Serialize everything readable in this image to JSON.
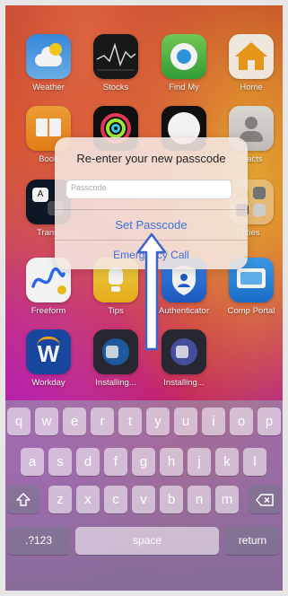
{
  "home": {
    "apps": [
      {
        "id": "weather",
        "label": "Weather"
      },
      {
        "id": "stocks",
        "label": "Stocks"
      },
      {
        "id": "findmy",
        "label": "Find My"
      },
      {
        "id": "home",
        "label": "Home"
      },
      {
        "id": "books",
        "label": "Book"
      },
      {
        "id": "fitness",
        "label": ""
      },
      {
        "id": "clock",
        "label": ""
      },
      {
        "id": "contacts",
        "label": "ntacts"
      },
      {
        "id": "translate",
        "label": "Transl"
      },
      {
        "id": "utilities",
        "label": "lities"
      },
      {
        "id": "freeform",
        "label": "Freeform"
      },
      {
        "id": "tips",
        "label": "Tips"
      },
      {
        "id": "authenticator",
        "label": "Authenticator"
      },
      {
        "id": "compportal",
        "label": "Comp Portal"
      },
      {
        "id": "workday",
        "label": "Workday"
      },
      {
        "id": "installing1",
        "label": "Installing..."
      },
      {
        "id": "installing2",
        "label": "Installing..."
      }
    ]
  },
  "alert": {
    "title": "Re-enter your new passcode",
    "placeholder": "Passcode",
    "primary_button": "Set Passcode",
    "secondary_button": "Emergency Call"
  },
  "keyboard": {
    "row1": [
      "q",
      "w",
      "e",
      "r",
      "t",
      "y",
      "u",
      "i",
      "o",
      "p"
    ],
    "row2": [
      "a",
      "s",
      "d",
      "f",
      "g",
      "h",
      "j",
      "k",
      "l"
    ],
    "row3": [
      "z",
      "x",
      "c",
      "v",
      "b",
      "n",
      "m"
    ],
    "numbers_key": ".?123",
    "space_key": "space",
    "return_key": "return",
    "shift_icon": "shift-icon",
    "delete_icon": "delete-icon"
  },
  "colors": {
    "accent": "#3a72d8",
    "annotation_arrow": "#3b63c9"
  }
}
